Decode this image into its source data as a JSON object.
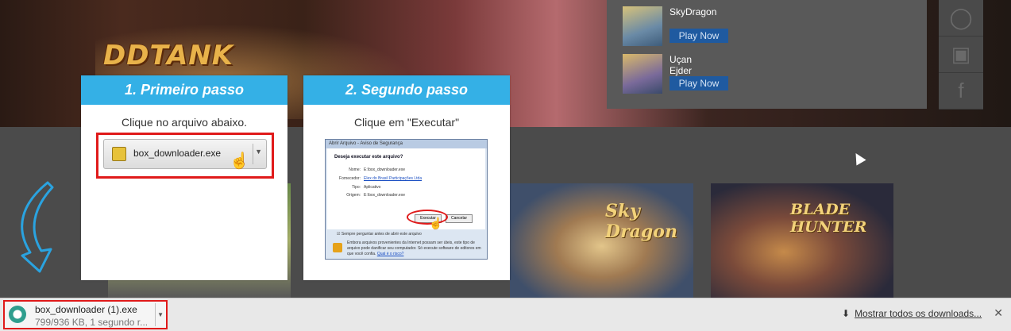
{
  "background_page": {
    "game_logo": "DDTANK",
    "side_games": [
      {
        "name": "SkyDragon",
        "button": "Play Now"
      },
      {
        "name": "Uçan Ejder",
        "button": "Play Now"
      }
    ],
    "social_icons": [
      "medal-icon",
      "gamepad-icon",
      "facebook-icon"
    ],
    "cards": [
      "",
      "Sky Dragon",
      "BLADE HUNTER"
    ]
  },
  "step1": {
    "title": "1. Primeiro passo",
    "instruction": "Clique no arquivo abaixo.",
    "file_button": "box_downloader.exe"
  },
  "step2": {
    "title": "2. Segundo passo",
    "instruction": "Clique em \"Executar\"",
    "dialog": {
      "title": "Abrir Arquivo - Aviso de Segurança",
      "question": "Deseja executar este arquivo?",
      "fields": [
        {
          "key": "Nome:",
          "value": "E:\\box_downloader.exe"
        },
        {
          "key": "Fornecedor:",
          "value": "Elex do Brasil Participações Ltda"
        },
        {
          "key": "Tipo:",
          "value": "Aplicativo"
        },
        {
          "key": "Origem:",
          "value": "E:\\box_downloader.exe"
        }
      ],
      "run_button": "Executar",
      "cancel_button": "Cancelar",
      "checkbox": "Sempre perguntar antes de abrir este arquivo",
      "warning": "Embora arquivos provenientes da Internet possam ser úteis, este tipo de arquivo pode danificar seu computador. Só execute software de editores em que você confia.",
      "warning_link": "Qual é o risco?"
    }
  },
  "download_bar": {
    "filename": "box_downloader (1).exe",
    "status": "799/936 KB, 1 segundo r...",
    "show_all": "Mostrar todos os downloads...",
    "close": "✕"
  },
  "colors": {
    "accent_blue": "#34b0e6",
    "highlight_red": "#e01a1a"
  }
}
